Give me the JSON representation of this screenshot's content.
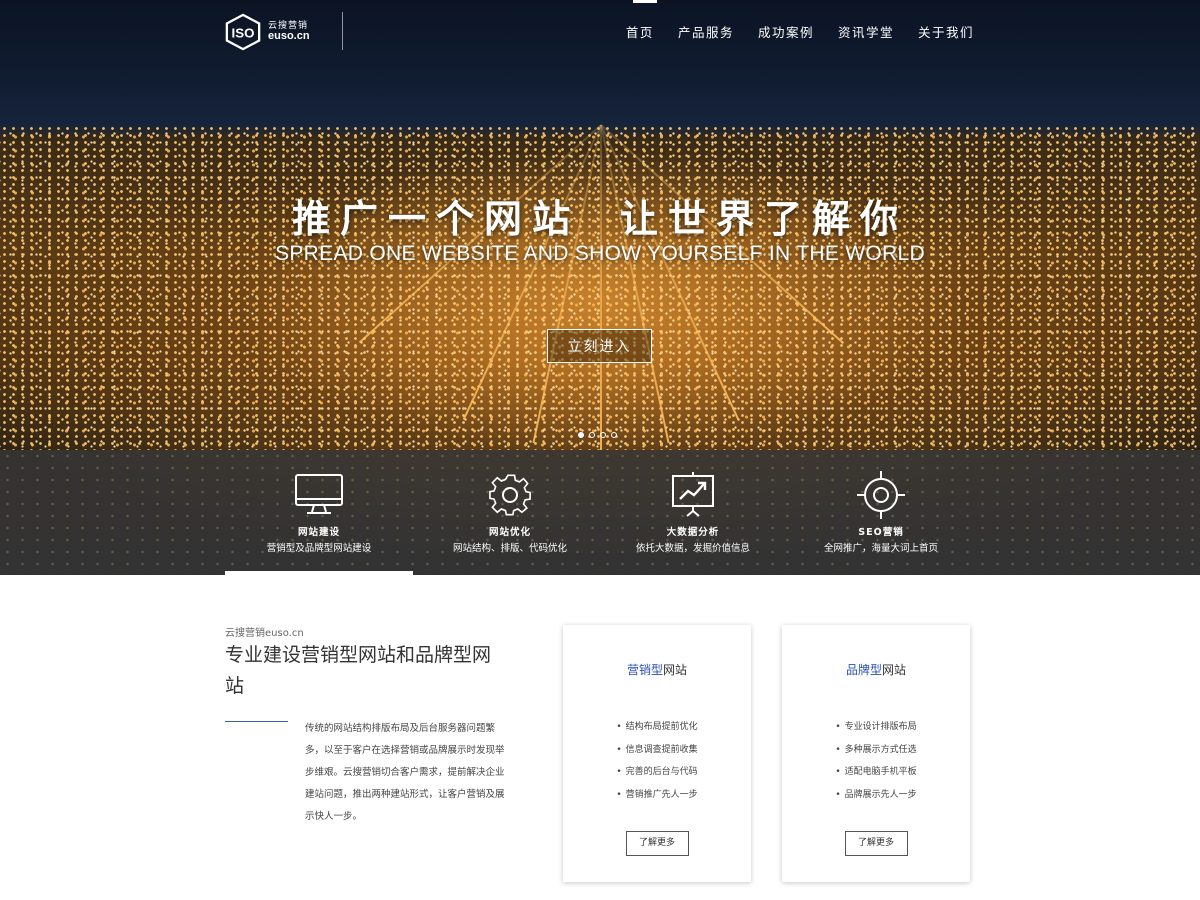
{
  "header": {
    "logo": {
      "mark": "ISO",
      "name_cn": "云搜营销",
      "name_en": "euso.cn"
    },
    "nav": [
      "首页",
      "产品服务",
      "成功案例",
      "资讯学堂",
      "关于我们"
    ]
  },
  "hero": {
    "title_part1": "推广一个网站",
    "title_part2": "让世界了解你",
    "subtitle": "SPREAD ONE WEBSITE AND SHOW YOURSELF IN THE WORLD",
    "cta": "立刻进入",
    "slide_count": 4,
    "active_slide": 1
  },
  "services": [
    {
      "icon": "monitor-icon",
      "title": "网站建设",
      "desc": "营销型及品牌型网站建设"
    },
    {
      "icon": "gear-icon",
      "title": "网站优化",
      "desc": "网站结构、排版、代码优化"
    },
    {
      "icon": "presentation-chart-icon",
      "title": "大数据分析",
      "desc": "依托大数据，发掘价值信息"
    },
    {
      "icon": "target-icon",
      "title": "SEO营销",
      "desc": "全网推广，海量大词上首页"
    }
  ],
  "intro": {
    "kicker": "云搜营销euso.cn",
    "title": "专业建设营销型网站和品牌型网站",
    "text": "传统的网站结构排版布局及后台服务器问题繁多，以至于客户在选择营销或品牌展示时发现举步维艰。云搜营销切合客户需求，提前解决企业建站问题，推出两种建站形式，让客户营销及展示快人一步。"
  },
  "cards": [
    {
      "title_highlight": "营销型",
      "title_rest": "网站",
      "items": [
        "结构布局提前优化",
        "信息调查提前收集",
        "完善的后台与代码",
        "营销推广先人一步"
      ],
      "button": "了解更多"
    },
    {
      "title_highlight": "品牌型",
      "title_rest": "网站",
      "items": [
        "专业设计排版布局",
        "多种展示方式任选",
        "适配电脑手机平板",
        "品牌展示先人一步"
      ],
      "button": "了解更多"
    }
  ],
  "colors": {
    "accent": "#2a4fb5",
    "band": "#373737",
    "text": "#333333"
  }
}
